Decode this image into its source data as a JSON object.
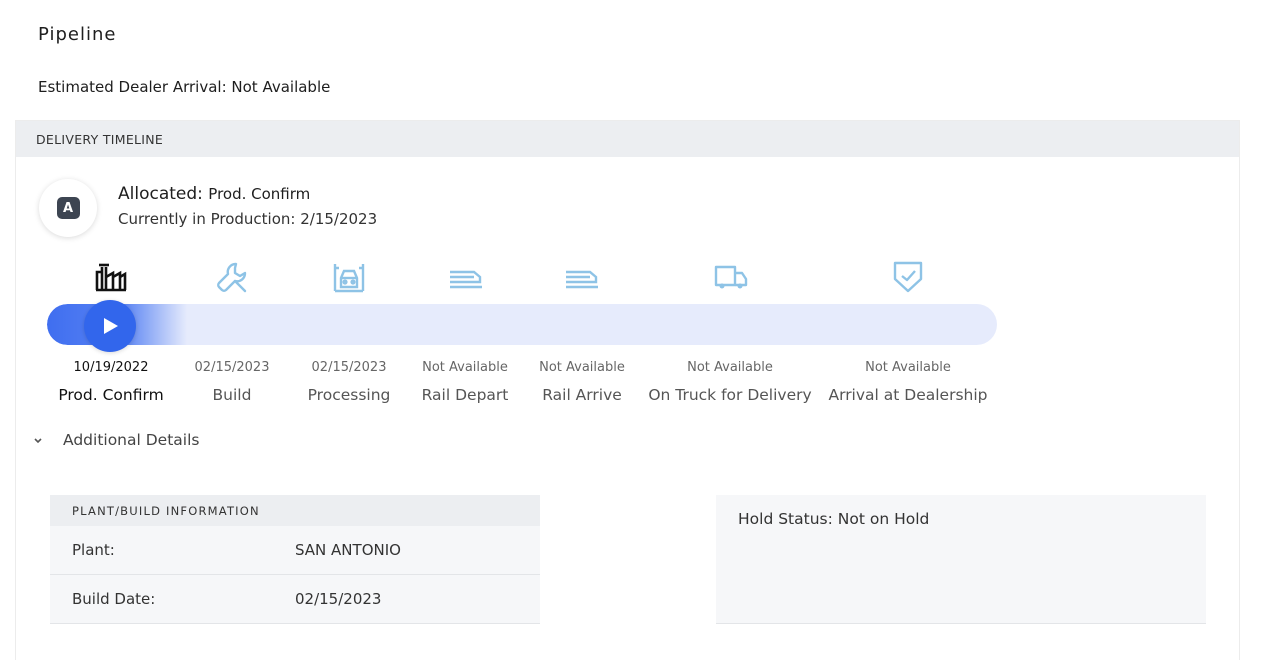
{
  "page": {
    "title": "Pipeline",
    "eta": "Estimated Dealer Arrival: Not Available"
  },
  "timeline": {
    "header": "DELIVERY TIMELINE",
    "avatar_letter": "A",
    "status_main": "Allocated:",
    "status_stage": "Prod. Confirm",
    "status_sub": "Currently in Production: 2/15/2023",
    "progress_fraction": 0.0,
    "stages": [
      {
        "label": "Prod. Confirm",
        "date": "10/19/2022",
        "icon": "factory-icon",
        "active": true
      },
      {
        "label": "Build",
        "date": "02/15/2023",
        "icon": "wrench-icon",
        "active": false
      },
      {
        "label": "Processing",
        "date": "02/15/2023",
        "icon": "car-processing-icon",
        "active": false
      },
      {
        "label": "Rail Depart",
        "date": "Not Available",
        "icon": "rail-icon",
        "active": false
      },
      {
        "label": "Rail Arrive",
        "date": "Not Available",
        "icon": "rail-icon",
        "active": false
      },
      {
        "label": "On Truck for Delivery",
        "date": "Not Available",
        "icon": "truck-icon",
        "active": false
      },
      {
        "label": "Arrival at Dealership",
        "date": "Not Available",
        "icon": "shield-check-icon",
        "active": false
      }
    ]
  },
  "details": {
    "toggle_label": "Additional Details",
    "plant_header": "PLANT/BUILD INFORMATION",
    "rows": [
      {
        "key": "Plant:",
        "value": "SAN ANTONIO"
      },
      {
        "key": "Build Date:",
        "value": "02/15/2023"
      }
    ],
    "hold_status": "Hold Status: Not on Hold"
  },
  "colors": {
    "accent": "#3266ec",
    "track": "#e6ebfc",
    "icon_inactive": "#8ec3e6",
    "icon_active": "#111111"
  }
}
